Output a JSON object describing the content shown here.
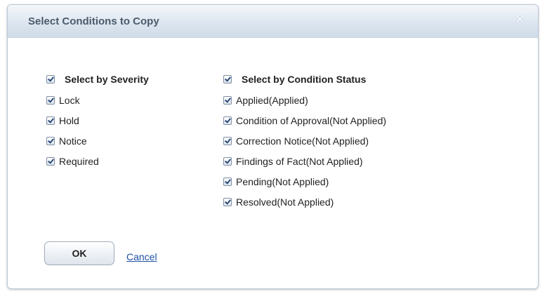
{
  "dialog": {
    "title": "Select Conditions to Copy",
    "close_glyph": "×"
  },
  "severity": {
    "header": "Select by Severity",
    "header_checked": true,
    "items": [
      {
        "label": "Lock",
        "checked": true
      },
      {
        "label": "Hold",
        "checked": true
      },
      {
        "label": "Notice",
        "checked": true
      },
      {
        "label": "Required",
        "checked": true
      }
    ]
  },
  "status": {
    "header": "Select by Condition Status",
    "header_checked": true,
    "items": [
      {
        "label": "Applied(Applied)",
        "checked": true
      },
      {
        "label": "Condition of Approval(Not Applied)",
        "checked": true
      },
      {
        "label": "Correction Notice(Not Applied)",
        "checked": true
      },
      {
        "label": "Findings of Fact(Not Applied)",
        "checked": true
      },
      {
        "label": "Pending(Not Applied)",
        "checked": true
      },
      {
        "label": "Resolved(Not Applied)",
        "checked": true
      }
    ]
  },
  "buttons": {
    "ok": "OK",
    "cancel": "Cancel"
  }
}
